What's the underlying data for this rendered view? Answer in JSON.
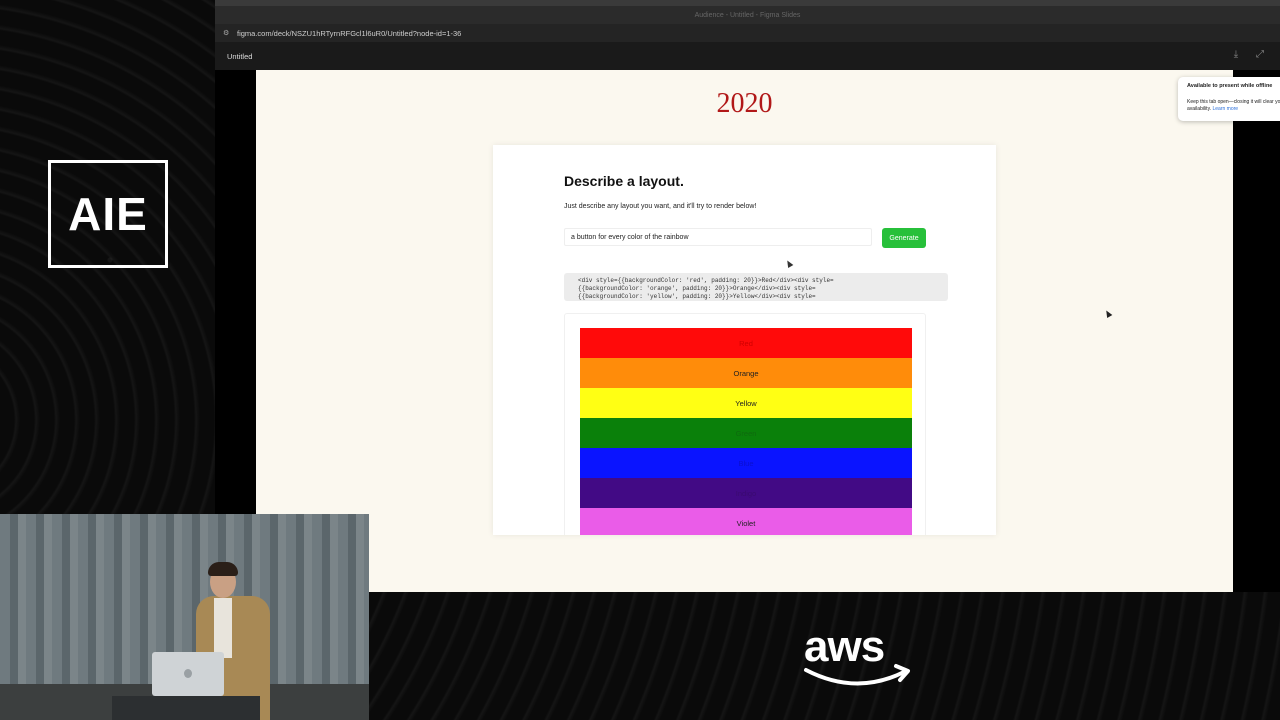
{
  "branding": {
    "event_logo": "AIE",
    "sponsor_logo": "aws"
  },
  "browser": {
    "window_title": "Audience - Untitled - Figma Slides",
    "url": "figma.com/deck/NSZU1hRTyrnRFGcl1l6uR0/Untitled?node-id=1-36",
    "tab_label": "Untitled"
  },
  "slide": {
    "year": "2020"
  },
  "app": {
    "heading": "Describe a layout.",
    "subtitle": "Just describe any layout you want, and it'll try to render below!",
    "prompt_value": "a button for every color of the rainbow",
    "generate_label": "Generate",
    "code_lines": [
      "<div style={{backgroundColor: 'red', padding: 20}}>Red</div><div style=",
      "{{backgroundColor: 'orange', padding: 20}}>Orange</div><div style=",
      "{{backgroundColor: 'yellow', padding: 20}}>Yellow</div><div style="
    ],
    "rainbow_buttons": [
      {
        "label": "Red",
        "color": "#ff0a0a",
        "text_color": "#d00000"
      },
      {
        "label": "Orange",
        "color": "#ff8c0a",
        "text_color": "#222222"
      },
      {
        "label": "Yellow",
        "color": "#ffff14",
        "text_color": "#222222"
      },
      {
        "label": "Green",
        "color": "#0a800a",
        "text_color": "#0e6a0e"
      },
      {
        "label": "Blue",
        "color": "#0a14ff",
        "text_color": "#0a10d0"
      },
      {
        "label": "Indigo",
        "color": "#420a85",
        "text_color": "#3a0a70"
      },
      {
        "label": "Violet",
        "color": "#ea5ce8",
        "text_color": "#222222"
      }
    ]
  },
  "toast": {
    "title": "Available to present while offline",
    "body": "Keep this tab open—closing it will clear your offline availability.",
    "link": "Learn more"
  }
}
